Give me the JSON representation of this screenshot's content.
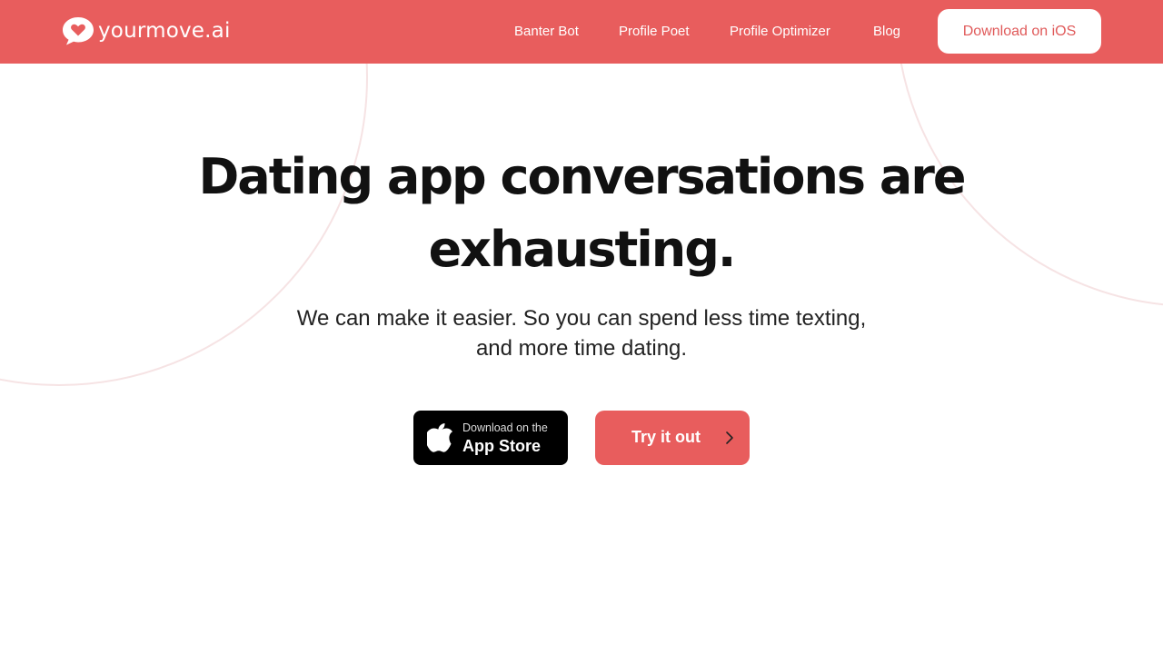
{
  "brand": {
    "name": "yourmove.ai",
    "accent_color": "#e85d5d"
  },
  "nav": {
    "items": [
      {
        "label": "Banter Bot"
      },
      {
        "label": "Profile Poet"
      },
      {
        "label": "Profile Optimizer"
      },
      {
        "label": "Blog"
      }
    ],
    "cta_label": "Download on iOS"
  },
  "hero": {
    "title_line1": "Dating app conversations are",
    "title_line2": "exhausting.",
    "subtitle_line1": "We can make it easier. So you can spend less time texting,",
    "subtitle_line2": "and more time dating."
  },
  "buttons": {
    "app_store_small": "Download on the",
    "app_store_big": "App Store",
    "try_label": "Try it out"
  },
  "icons": {
    "logo": "heart-chat-bubble-icon",
    "app_store": "apple-icon",
    "try": "chevron-right-icon"
  }
}
